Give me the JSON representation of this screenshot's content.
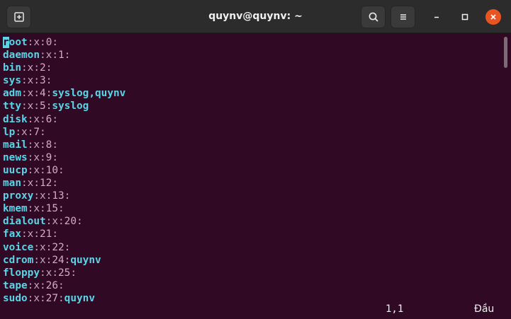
{
  "window": {
    "title": "quynv@quynv: ~"
  },
  "titlebar": {
    "new_tab_icon": "new-tab-icon",
    "search_icon": "search-icon",
    "menu_icon": "hamburger-menu-icon",
    "minimize_icon": "minimize-icon",
    "maximize_icon": "maximize-icon",
    "close_icon": "close-icon",
    "close_color": "#e95420"
  },
  "terminal": {
    "background": "#300a24",
    "name_color": "#5ad4e6",
    "lines": [
      {
        "name": "root",
        "gid": "0",
        "members": ""
      },
      {
        "name": "daemon",
        "gid": "1",
        "members": ""
      },
      {
        "name": "bin",
        "gid": "2",
        "members": ""
      },
      {
        "name": "sys",
        "gid": "3",
        "members": ""
      },
      {
        "name": "adm",
        "gid": "4",
        "members": "syslog,quynv"
      },
      {
        "name": "tty",
        "gid": "5",
        "members": "syslog"
      },
      {
        "name": "disk",
        "gid": "6",
        "members": ""
      },
      {
        "name": "lp",
        "gid": "7",
        "members": ""
      },
      {
        "name": "mail",
        "gid": "8",
        "members": ""
      },
      {
        "name": "news",
        "gid": "9",
        "members": ""
      },
      {
        "name": "uucp",
        "gid": "10",
        "members": ""
      },
      {
        "name": "man",
        "gid": "12",
        "members": ""
      },
      {
        "name": "proxy",
        "gid": "13",
        "members": ""
      },
      {
        "name": "kmem",
        "gid": "15",
        "members": ""
      },
      {
        "name": "dialout",
        "gid": "20",
        "members": ""
      },
      {
        "name": "fax",
        "gid": "21",
        "members": ""
      },
      {
        "name": "voice",
        "gid": "22",
        "members": ""
      },
      {
        "name": "cdrom",
        "gid": "24",
        "members": "quynv"
      },
      {
        "name": "floppy",
        "gid": "25",
        "members": ""
      },
      {
        "name": "tape",
        "gid": "26",
        "members": ""
      },
      {
        "name": "sudo",
        "gid": "27",
        "members": "quynv"
      }
    ],
    "status": {
      "cursor_position": "1,1",
      "scroll_position": "Đầu"
    }
  }
}
